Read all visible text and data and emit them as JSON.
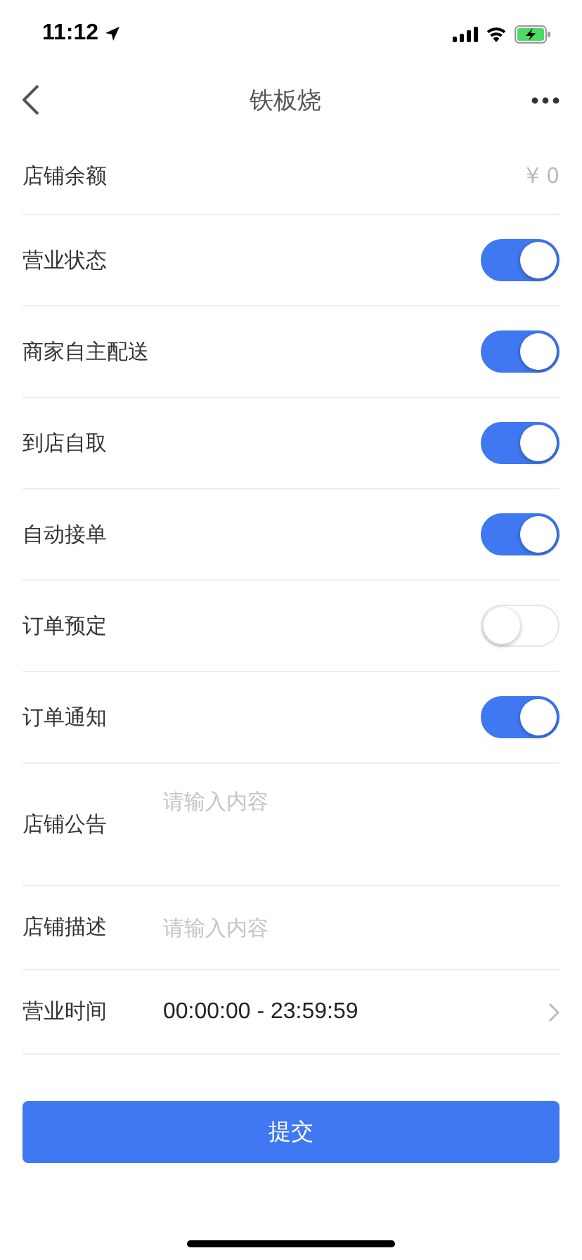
{
  "status_bar": {
    "time": "11:12"
  },
  "nav": {
    "title": "铁板烧"
  },
  "rows": [
    {
      "kind": "value",
      "label": "店铺余额",
      "value": "¥ 0"
    },
    {
      "kind": "switch",
      "label": "营业状态",
      "on": true
    },
    {
      "kind": "switch",
      "label": "商家自主配送",
      "on": true
    },
    {
      "kind": "switch",
      "label": "到店自取",
      "on": true
    },
    {
      "kind": "switch",
      "label": "自动接单",
      "on": true
    },
    {
      "kind": "switch",
      "label": "订单预定",
      "on": false
    },
    {
      "kind": "switch",
      "label": "订单通知",
      "on": true
    },
    {
      "kind": "textarea",
      "label": "店铺公告",
      "placeholder": "请输入内容"
    },
    {
      "kind": "input",
      "label": "店铺描述",
      "placeholder": "请输入内容"
    },
    {
      "kind": "picker",
      "label": "营业时间",
      "value": "00:00:00 - 23:59:59"
    }
  ],
  "submit": "提交"
}
